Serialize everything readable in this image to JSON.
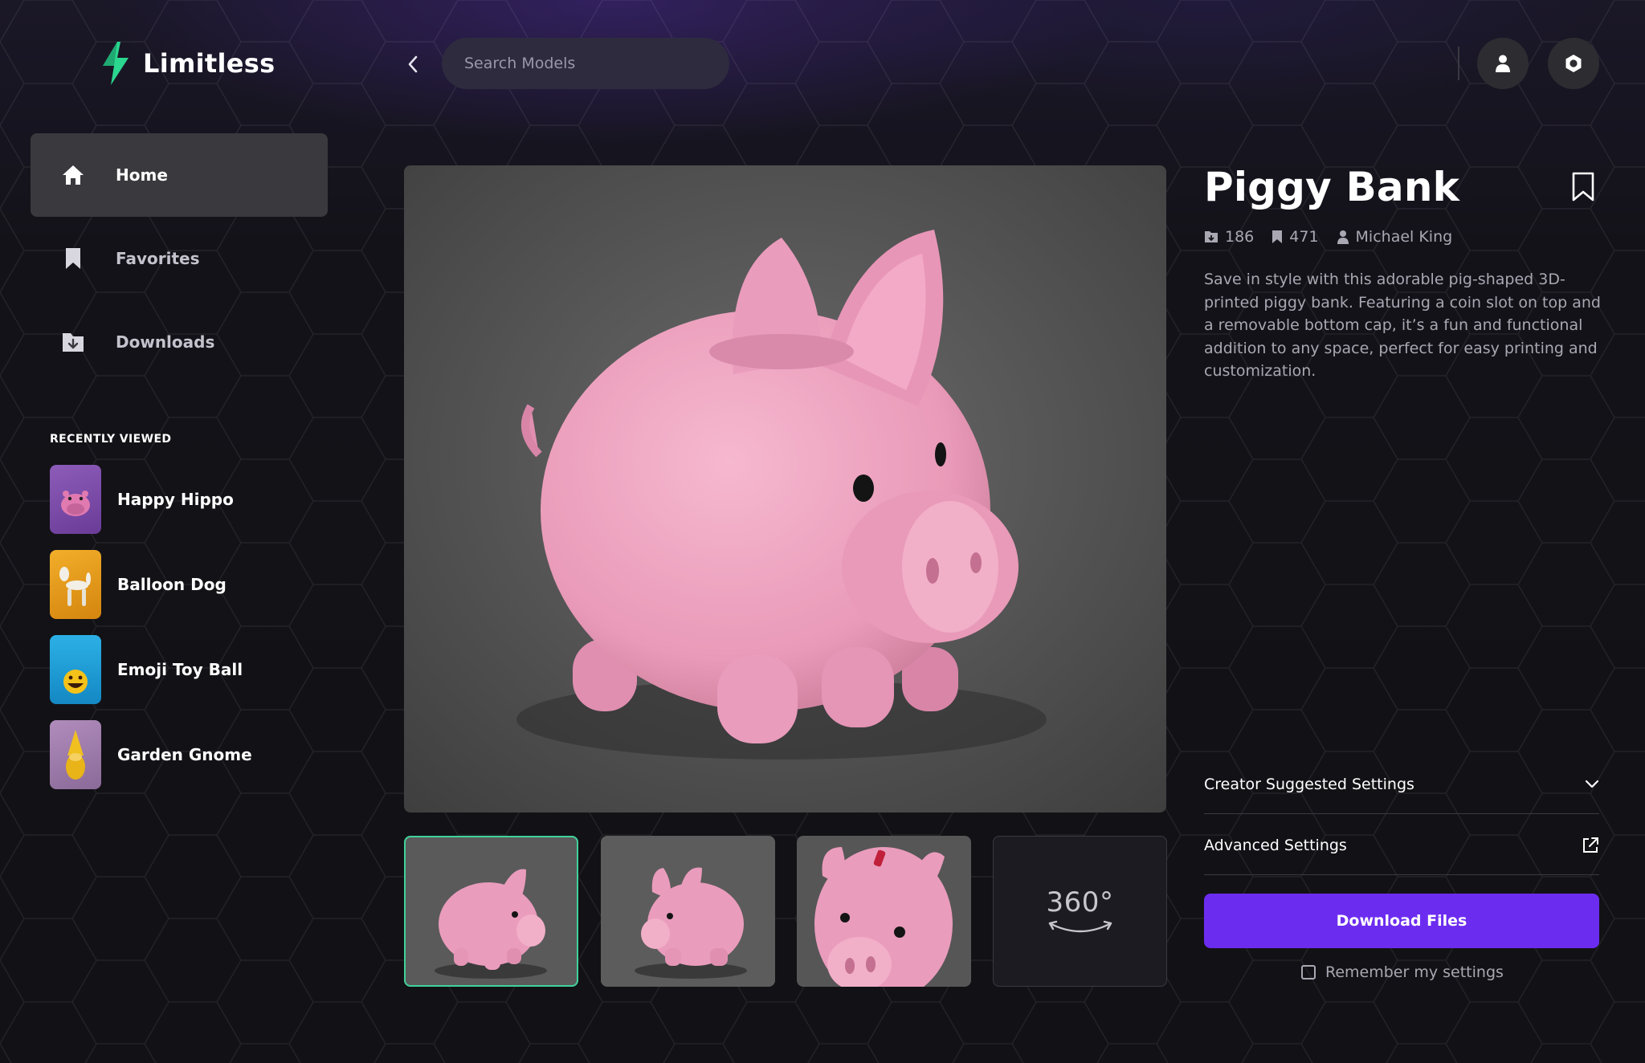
{
  "app": {
    "name": "Limitless"
  },
  "header": {
    "search_placeholder": "Search Models",
    "back_icon": "chevron-left-icon",
    "user_icon": "user-icon",
    "settings_icon": "settings-icon"
  },
  "sidebar": {
    "nav": [
      {
        "label": "Home",
        "icon": "home-icon",
        "active": true
      },
      {
        "label": "Favorites",
        "icon": "bookmark-icon",
        "active": false
      },
      {
        "label": "Downloads",
        "icon": "download-folder-icon",
        "active": false
      }
    ],
    "recent_title": "RECENTLY VIEWED",
    "recent": [
      {
        "label": "Happy Hippo",
        "color": "#7a4aa8"
      },
      {
        "label": "Balloon Dog",
        "color": "#e0961a"
      },
      {
        "label": "Emoji Toy Ball",
        "color": "#1aa0d8"
      },
      {
        "label": "Garden Gnome",
        "color": "#9a7aa8"
      }
    ]
  },
  "model": {
    "title": "Piggy Bank",
    "downloads": "186",
    "saves": "471",
    "author": "Michael King",
    "description": "Save in style with this adorable pig-shaped 3D-printed piggy bank. Featuring a coin slot on top and a removable bottom cap, it’s a fun and functional addition to any space, perfect for easy printing and customization.",
    "thumbnails_count": 3,
    "view_360_label": "360°"
  },
  "settings": {
    "creator_suggested": "Creator Suggested Settings",
    "advanced": "Advanced Settings",
    "download_label": "Download Files",
    "remember_label": "Remember my settings"
  },
  "colors": {
    "accent": "#6c2cf0",
    "selected_outline": "#3fd29a",
    "logo_green": "#2bd68f",
    "pig_pink": "#e99ab8"
  }
}
